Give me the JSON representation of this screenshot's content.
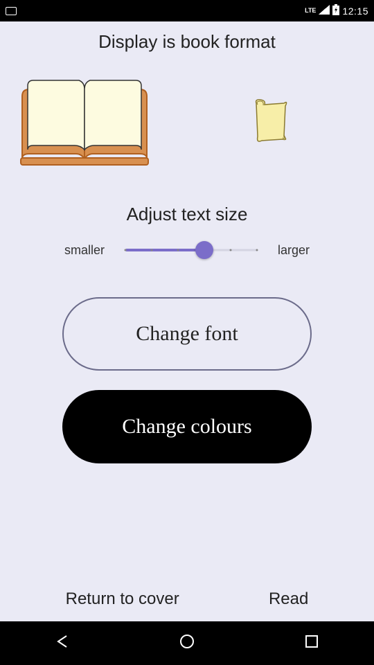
{
  "status": {
    "time": "12:15",
    "lte": "LTE",
    "signal_icon": "signal-icon",
    "battery_icon": "battery-charging-icon",
    "sd_icon": "sd-card-icon"
  },
  "title": "Display is book format",
  "format_options": {
    "book_icon": "open-book-icon",
    "scroll_icon": "scroll-icon"
  },
  "text_size": {
    "label": "Adjust text size",
    "min_label": "smaller",
    "max_label": "larger",
    "value": 3,
    "max": 5
  },
  "buttons": {
    "change_font": "Change font",
    "change_colours": "Change colours"
  },
  "bottom": {
    "return": "Return to cover",
    "read": "Read"
  },
  "nav": {
    "back": "back-icon",
    "home": "home-icon",
    "recent": "recent-icon"
  }
}
